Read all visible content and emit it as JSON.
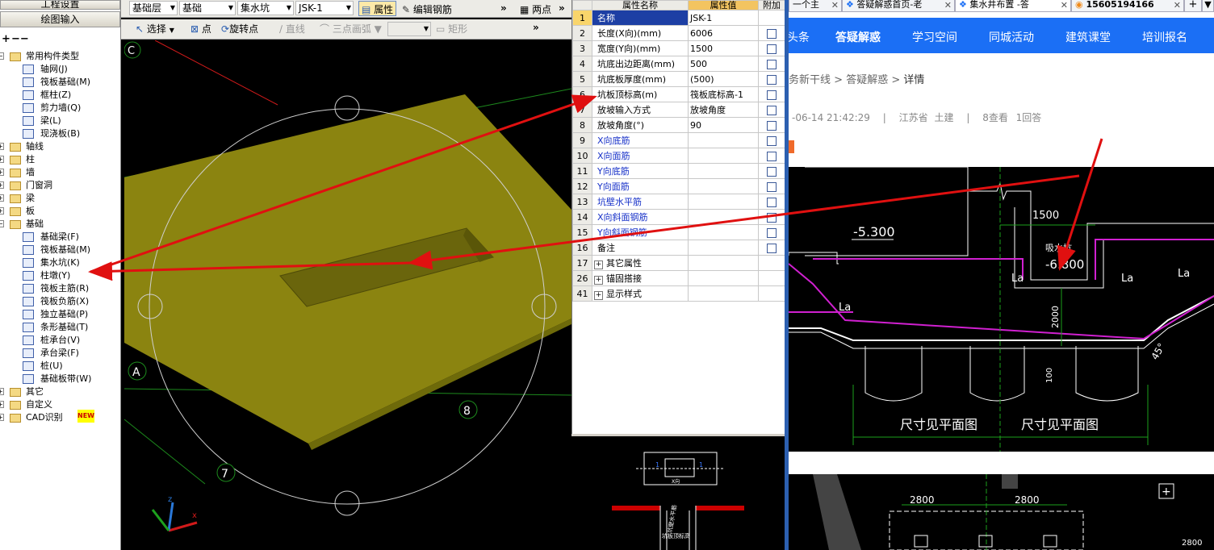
{
  "left_panel": {
    "top_button": "工程设置",
    "drawing_input_button": "绘图输入",
    "tree": [
      {
        "label": "常用构件类型",
        "level": 0,
        "expanded": true,
        "kind": "folder"
      },
      {
        "label": "轴网(J)",
        "level": 1,
        "kind": "item"
      },
      {
        "label": "筏板基础(M)",
        "level": 1,
        "kind": "item"
      },
      {
        "label": "框柱(Z)",
        "level": 1,
        "kind": "item"
      },
      {
        "label": "剪力墙(Q)",
        "level": 1,
        "kind": "item"
      },
      {
        "label": "梁(L)",
        "level": 1,
        "kind": "item"
      },
      {
        "label": "现浇板(B)",
        "level": 1,
        "kind": "item"
      },
      {
        "label": "轴线",
        "level": 0,
        "expanded": false,
        "kind": "folder"
      },
      {
        "label": "柱",
        "level": 0,
        "expanded": false,
        "kind": "folder"
      },
      {
        "label": "墙",
        "level": 0,
        "expanded": false,
        "kind": "folder"
      },
      {
        "label": "门窗洞",
        "level": 0,
        "expanded": false,
        "kind": "folder"
      },
      {
        "label": "梁",
        "level": 0,
        "expanded": false,
        "kind": "folder"
      },
      {
        "label": "板",
        "level": 0,
        "expanded": false,
        "kind": "folder"
      },
      {
        "label": "基础",
        "level": 0,
        "expanded": true,
        "kind": "folder"
      },
      {
        "label": "基础梁(F)",
        "level": 1,
        "kind": "item"
      },
      {
        "label": "筏板基础(M)",
        "level": 1,
        "kind": "item"
      },
      {
        "label": "集水坑(K)",
        "level": 1,
        "kind": "item"
      },
      {
        "label": "柱墩(Y)",
        "level": 1,
        "kind": "item"
      },
      {
        "label": "筏板主筋(R)",
        "level": 1,
        "kind": "item"
      },
      {
        "label": "筏板负筋(X)",
        "level": 1,
        "kind": "item"
      },
      {
        "label": "独立基础(P)",
        "level": 1,
        "kind": "item"
      },
      {
        "label": "条形基础(T)",
        "level": 1,
        "kind": "item"
      },
      {
        "label": "桩承台(V)",
        "level": 1,
        "kind": "item"
      },
      {
        "label": "承台梁(F)",
        "level": 1,
        "kind": "item"
      },
      {
        "label": "桩(U)",
        "level": 1,
        "kind": "item"
      },
      {
        "label": "基础板带(W)",
        "level": 1,
        "kind": "item"
      },
      {
        "label": "其它",
        "level": 0,
        "expanded": false,
        "kind": "folder"
      },
      {
        "label": "自定义",
        "level": 0,
        "expanded": false,
        "kind": "folder"
      },
      {
        "label": "CAD识别",
        "level": 0,
        "expanded": false,
        "kind": "folder",
        "badge": "NEW"
      }
    ]
  },
  "toolbar1": {
    "floor": "基础层",
    "category": "基础",
    "component_type": "集水坑",
    "component": "JSK-1",
    "property_button": "属性",
    "edit_rebar_button": "编辑钢筋",
    "two_points": "两点"
  },
  "toolbar2": {
    "select": "选择",
    "point": "点",
    "rotate_point": "旋转点",
    "line": "直线",
    "arc3": "三点画弧",
    "rect": "矩形"
  },
  "viewport": {
    "axis_labels": [
      "C",
      "A",
      "8",
      "7"
    ],
    "colors": {
      "slab": "#8b8410",
      "slab_edge": "#6e6a0a",
      "red_line": "#d11a1a",
      "grid_line": "#1d8a1d"
    }
  },
  "properties": {
    "header_name": "属性名称",
    "header_value": "属性值",
    "header_extra": "附加",
    "rows": [
      {
        "num": "1",
        "name": "名称",
        "value": "JSK-1",
        "blue": false,
        "checkbox": false,
        "selected": true
      },
      {
        "num": "2",
        "name": "长度(X向)(mm)",
        "value": "6006",
        "blue": false,
        "checkbox": true
      },
      {
        "num": "3",
        "name": "宽度(Y向)(mm)",
        "value": "1500",
        "blue": false,
        "checkbox": true
      },
      {
        "num": "4",
        "name": "坑底出边距离(mm)",
        "value": "500",
        "blue": false,
        "checkbox": true
      },
      {
        "num": "5",
        "name": "坑底板厚度(mm)",
        "value": "(500)",
        "blue": false,
        "checkbox": true
      },
      {
        "num": "6",
        "name": "坑板顶标高(m)",
        "value": "筏板底标高-1",
        "blue": false,
        "checkbox": true
      },
      {
        "num": "7",
        "name": "放坡输入方式",
        "value": "放坡角度",
        "blue": false,
        "checkbox": true
      },
      {
        "num": "8",
        "name": "放坡角度(°)",
        "value": "90",
        "blue": false,
        "checkbox": true
      },
      {
        "num": "9",
        "name": "X向底筋",
        "value": "",
        "blue": true,
        "checkbox": true
      },
      {
        "num": "10",
        "name": "X向面筋",
        "value": "",
        "blue": true,
        "checkbox": true
      },
      {
        "num": "11",
        "name": "Y向底筋",
        "value": "",
        "blue": true,
        "checkbox": true
      },
      {
        "num": "12",
        "name": "Y向面筋",
        "value": "",
        "blue": true,
        "checkbox": true
      },
      {
        "num": "13",
        "name": "坑壁水平筋",
        "value": "",
        "blue": true,
        "checkbox": true
      },
      {
        "num": "14",
        "name": "X向斜面钢筋",
        "value": "",
        "blue": true,
        "checkbox": true
      },
      {
        "num": "15",
        "name": "Y向斜面钢筋",
        "value": "",
        "blue": true,
        "checkbox": true
      },
      {
        "num": "16",
        "name": "备注",
        "value": "",
        "blue": false,
        "checkbox": true
      },
      {
        "num": "17",
        "name": "其它属性",
        "value": "",
        "blue": false,
        "checkbox": false,
        "expander": true
      },
      {
        "num": "26",
        "name": "锚固搭接",
        "value": "",
        "blue": false,
        "checkbox": false,
        "expander": true
      },
      {
        "num": "41",
        "name": "显示样式",
        "value": "",
        "blue": false,
        "checkbox": false,
        "expander": true
      }
    ]
  },
  "preview": {
    "labels": [
      "1",
      "1",
      "X向",
      "坑壁水平筋",
      "坑板顶标高"
    ]
  },
  "browser": {
    "tabs": [
      {
        "title": "一个主",
        "active": false
      },
      {
        "title": "答疑解惑首页-老",
        "active": false
      },
      {
        "title": "集水井布置 -答",
        "active": true
      },
      {
        "title": "15605194166",
        "active": false
      }
    ],
    "new_tab": "+",
    "nav": [
      "头条",
      "答疑解惑",
      "学习空间",
      "同城活动",
      "建筑课堂",
      "培训报名"
    ],
    "breadcrumb": [
      "务新干线",
      "答疑解惑",
      "详情"
    ],
    "breadcrumb_sep": ">",
    "meta": {
      "date": "-06-14 21:42:29",
      "region": "江苏省",
      "specialty": "土建",
      "views": "8查看",
      "answers": "1回答"
    },
    "cad": {
      "elev1": "-5.300",
      "elev2": "-6.800",
      "pit_label": "吸水坑",
      "dim_top": "1500",
      "dim_depth": "2000",
      "dim_small": "100",
      "la": "La",
      "angle": "45°",
      "plan_note": "尺寸见平面图",
      "dim_bottom_1": "2800",
      "dim_bottom_2": "2800",
      "dim_bottom_3": "2800"
    },
    "colors": {
      "nav_bg": "#1b6ff5",
      "cad_bg": "#000000"
    }
  }
}
